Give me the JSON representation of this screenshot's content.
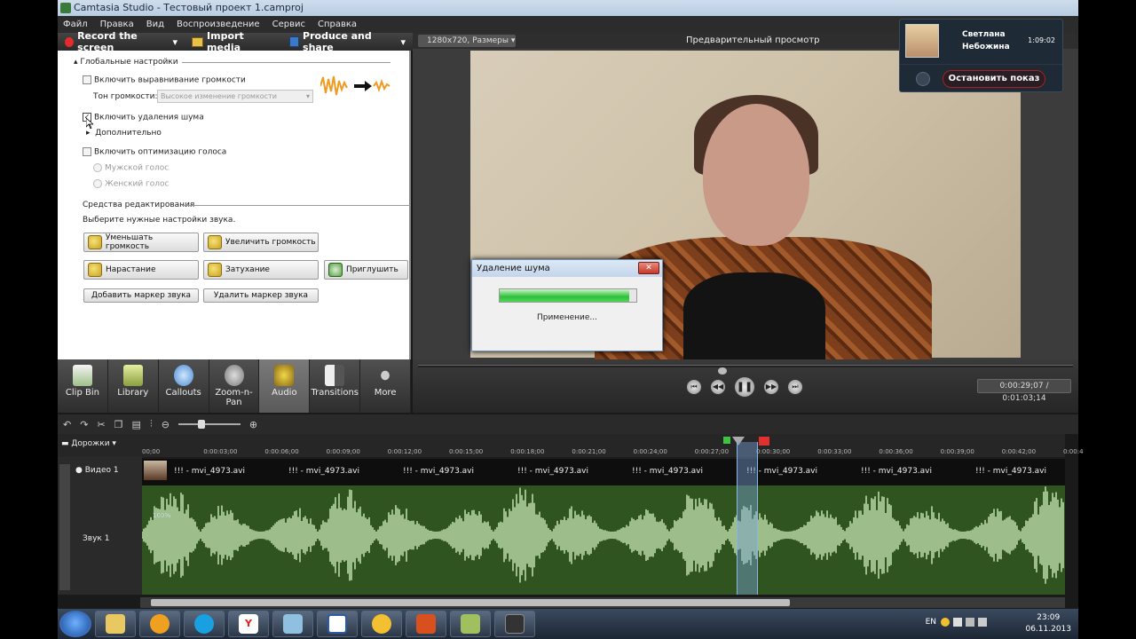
{
  "window": {
    "title": "Camtasia Studio - Тестовый проект 1.camproj"
  },
  "menu": [
    "Файл",
    "Правка",
    "Вид",
    "Воспроизведение",
    "Сервис",
    "Справка"
  ],
  "toolbar": {
    "record": "Record the screen",
    "import": "Import media",
    "produce": "Produce and share"
  },
  "audio_panel": {
    "global_settings": "Глобальные настройки",
    "volume_leveling": "Включить выравнивание громкости",
    "volume_tone_label": "Тон громкости:",
    "volume_tone_value": "Высокое изменение громкости",
    "noise_removal": "Включить удаления шума",
    "advanced": "Дополнительно",
    "voice_optimization": "Включить оптимизацию голоса",
    "male_voice": "Мужской голос",
    "female_voice": "Женский голос",
    "editing_tools": "Средства редактирования",
    "choose_settings": "Выберите нужные настройки звука.",
    "buttons": {
      "decrease": "Уменьшать громкость",
      "increase": "Увеличить громкость",
      "fade_in": "Нарастание",
      "fade_out": "Затухание",
      "silence": "Приглушить",
      "add_marker": "Добавить маркер звука",
      "delete_marker": "Удалить маркер звука"
    },
    "noise_removal_checked": true
  },
  "tabs": [
    {
      "label": "Clip Bin",
      "icon": "clip-bin-icon"
    },
    {
      "label": "Library",
      "icon": "library-icon"
    },
    {
      "label": "Callouts",
      "icon": "callouts-icon"
    },
    {
      "label": "Zoom-n-Pan",
      "icon": "zoom-icon"
    },
    {
      "label": "Audio",
      "icon": "speaker-icon"
    },
    {
      "label": "Transitions",
      "icon": "transitions-icon"
    },
    {
      "label": "More",
      "icon": "more-icon"
    }
  ],
  "active_tab": "Audio",
  "preview": {
    "size_label": "1280x720, Размеры",
    "title": "Предварительный просмотр",
    "timecode": "0:00:29;07 / 0:01:03;14"
  },
  "dialog": {
    "title": "Удаление шума",
    "status": "Применение...",
    "progress": 0.95
  },
  "timeline": {
    "tracks_label": "Дорожки",
    "ticks": [
      "00;00",
      "0:00:03;00",
      "0:00:06;00",
      "0:00:09;00",
      "0:00:12;00",
      "0:00:15;00",
      "0:00:18;00",
      "0:00:21;00",
      "0:00:24;00",
      "0:00:27;00",
      "0:00:30;00",
      "0:00:33;00",
      "0:00:36;00",
      "0:00:39;00",
      "0:00:42;00",
      "0:00:4"
    ],
    "video_track": "Видео 1",
    "audio_track": "Звук 1",
    "clip_name": "!!! - mvi_4973.avi",
    "clips_count_visible": 8,
    "audio_level": "100%"
  },
  "call": {
    "name_line1": "Светлана",
    "name_line2": "Небожина",
    "duration": "1:09:02",
    "stop_label": "Остановить показ"
  },
  "taskbar": {
    "lang": "EN",
    "time": "23:09",
    "date": "06.11.2013"
  },
  "colors": {
    "waveform": "#b9d8a6",
    "audio_bg": "#2f5420",
    "stop_border": "#a82020"
  }
}
